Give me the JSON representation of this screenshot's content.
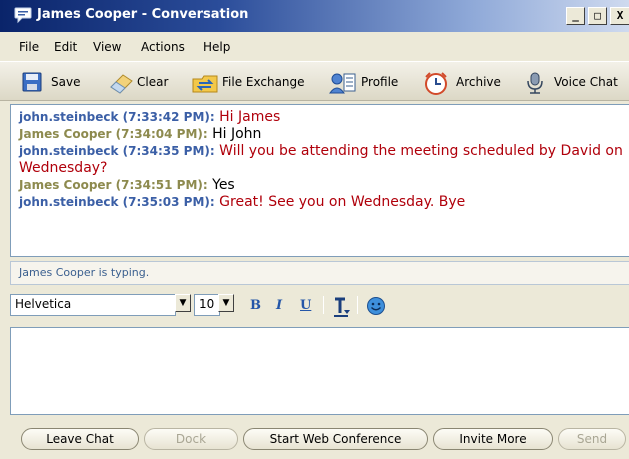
{
  "window": {
    "title": "James Cooper - Conversation",
    "controls": {
      "minimize": "_",
      "maximize": "□",
      "close": "X"
    }
  },
  "menu": [
    "File",
    "Edit",
    "View",
    "Actions",
    "Help"
  ],
  "toolbar": [
    {
      "label": "Save",
      "icon": "floppy-disk-icon"
    },
    {
      "label": "Clear",
      "icon": "eraser-icon"
    },
    {
      "label": "File Exchange",
      "icon": "folder-exchange-icon"
    },
    {
      "label": "Profile",
      "icon": "profile-card-icon"
    },
    {
      "label": "Archive",
      "icon": "clock-icon"
    },
    {
      "label": "Voice Chat",
      "icon": "microphone-icon"
    }
  ],
  "messages": [
    {
      "sender": "john.steinbeck (7:33:42 PM):",
      "text": "Hi James",
      "role": "external"
    },
    {
      "sender": "James Cooper (7:34:04 PM):",
      "text": "Hi John",
      "role": "self"
    },
    {
      "sender": "john.steinbeck (7:34:35 PM):",
      "text": "Will you be attending the meeting scheduled by David on Wednesday?",
      "role": "external"
    },
    {
      "sender": "James Cooper (7:34:51 PM):",
      "text": "Yes",
      "role": "self"
    },
    {
      "sender": "john.steinbeck (7:35:03 PM):",
      "text": "Great! See you on Wednesday. Bye",
      "role": "external"
    }
  ],
  "status": "James Cooper is typing.",
  "format": {
    "font": "Helvetica",
    "size": "10",
    "bold": "B",
    "italic": "I",
    "underline": "U"
  },
  "input": {
    "value": ""
  },
  "buttons": [
    {
      "label": "Leave Chat",
      "enabled": true
    },
    {
      "label": "Dock",
      "enabled": false
    },
    {
      "label": "Start Web Conference",
      "enabled": true
    },
    {
      "label": "Invite More",
      "enabled": true
    },
    {
      "label": "Send",
      "enabled": false
    }
  ],
  "colors": {
    "title_gradient_start": "#0a246a",
    "external_sender": "#3b5fa6",
    "external_text": "#b0000b",
    "self_sender": "#8d8a4e",
    "format_icons": "#2456a8"
  }
}
